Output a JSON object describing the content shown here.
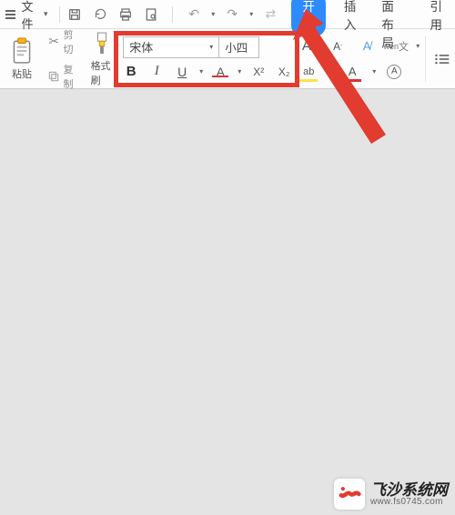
{
  "menu": {
    "file_label": "文件",
    "tabs": [
      "开始",
      "插入",
      "页面布局",
      "引用"
    ],
    "active_tab": "开始"
  },
  "ribbon": {
    "paste_label": "粘贴",
    "cut_label": "剪切",
    "copy_label": "复制",
    "format_painter_label": "格式刷"
  },
  "font": {
    "family": "宋体",
    "size": "小四"
  },
  "watermark": {
    "title": "飞沙系统网",
    "url": "www.fs0745.com"
  },
  "icons": {
    "hamburger": "hamburger-icon",
    "save": "save-icon",
    "reload": "reload-icon",
    "print": "print-icon",
    "preview": "preview-icon",
    "undo": "undo-icon",
    "redo": "redo-icon",
    "repeat": "repeat-icon",
    "scissors": "scissors-icon",
    "copy": "copy-icon",
    "brush": "brush-icon",
    "bold": "B",
    "italic": "I",
    "underline": "U",
    "strike": "A",
    "super": "X²",
    "sub": "X₂",
    "grow": "A⁺",
    "shrink": "A⁻",
    "clear": "A",
    "wen": "wén",
    "highlight": "ab",
    "fontcolor": "A",
    "circleA": "A",
    "list": "list-icon"
  }
}
